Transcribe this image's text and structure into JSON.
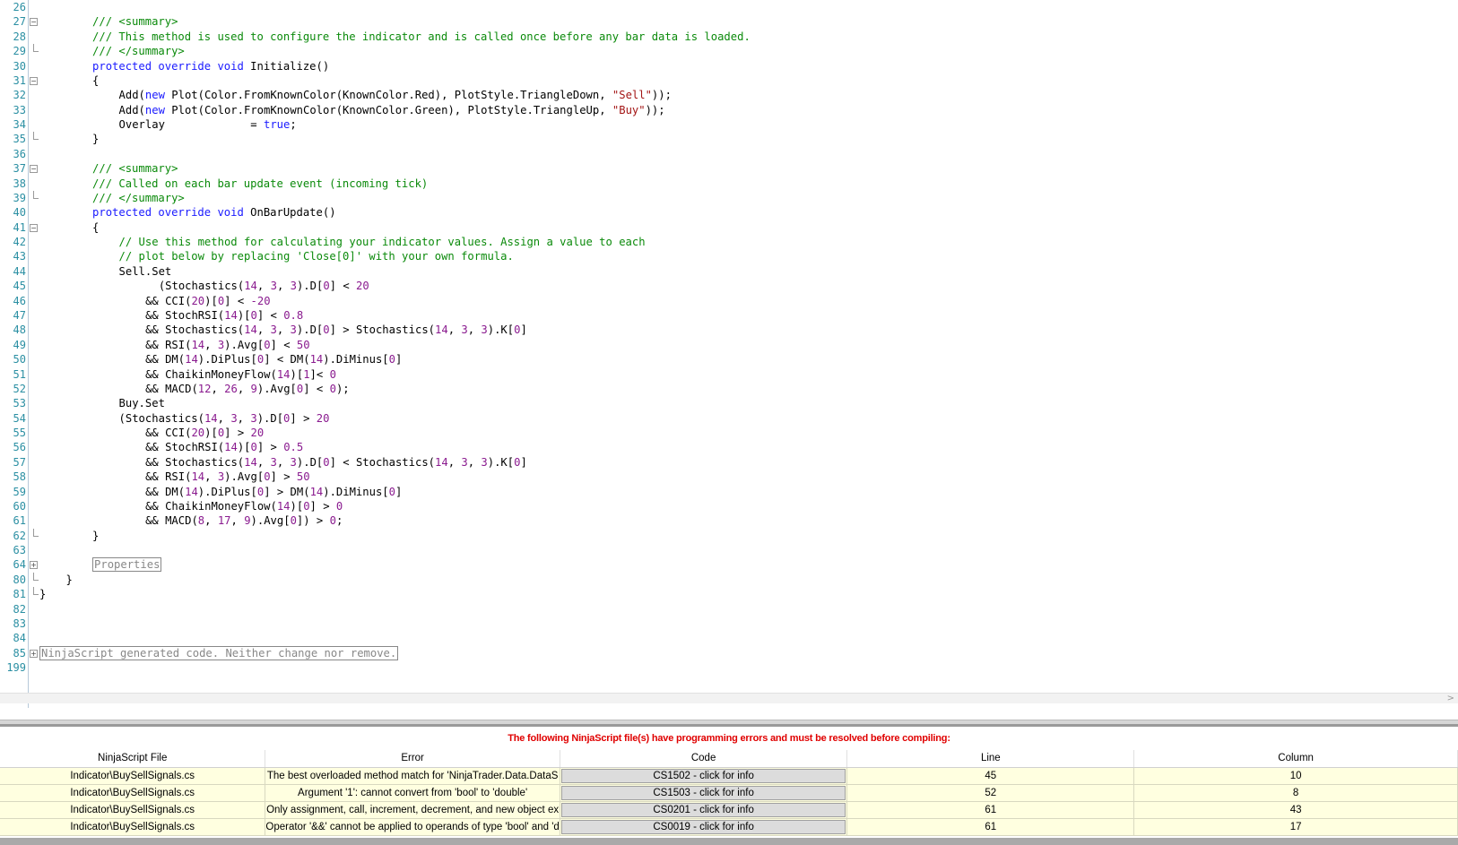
{
  "editor": {
    "lines": [
      {
        "n": "26",
        "fold": "none",
        "indent": 0,
        "parts": []
      },
      {
        "n": "27",
        "fold": "minus",
        "indent": 8,
        "parts": [
          [
            "cm",
            "/// <summary>"
          ]
        ]
      },
      {
        "n": "28",
        "fold": "line",
        "indent": 8,
        "parts": [
          [
            "cm",
            "/// This method is used to configure the indicator and is called once before any bar data is loaded."
          ]
        ]
      },
      {
        "n": "29",
        "fold": "end",
        "indent": 8,
        "parts": [
          [
            "cm",
            "/// </summary>"
          ]
        ]
      },
      {
        "n": "30",
        "fold": "line",
        "indent": 8,
        "parts": [
          [
            "kw",
            "protected override void "
          ],
          [
            "tx",
            "Initialize()"
          ]
        ]
      },
      {
        "n": "31",
        "fold": "minus",
        "indent": 8,
        "parts": [
          [
            "tx",
            "{"
          ]
        ]
      },
      {
        "n": "32",
        "fold": "line",
        "indent": 12,
        "parts": [
          [
            "tx",
            "Add("
          ],
          [
            "kw",
            "new "
          ],
          [
            "tx",
            "Plot(Color.FromKnownColor(KnownColor.Red), PlotStyle.TriangleDown, "
          ],
          [
            "str",
            "\"Sell\""
          ],
          [
            "tx",
            "));"
          ]
        ]
      },
      {
        "n": "33",
        "fold": "line",
        "indent": 12,
        "parts": [
          [
            "tx",
            "Add("
          ],
          [
            "kw",
            "new "
          ],
          [
            "tx",
            "Plot(Color.FromKnownColor(KnownColor.Green), PlotStyle.TriangleUp, "
          ],
          [
            "str",
            "\"Buy\""
          ],
          [
            "tx",
            "));"
          ]
        ]
      },
      {
        "n": "34",
        "fold": "line",
        "indent": 12,
        "parts": [
          [
            "tx",
            "Overlay             = "
          ],
          [
            "kw",
            "true"
          ],
          [
            "tx",
            ";"
          ]
        ]
      },
      {
        "n": "35",
        "fold": "end",
        "indent": 8,
        "parts": [
          [
            "tx",
            "}"
          ]
        ]
      },
      {
        "n": "36",
        "fold": "line",
        "indent": 0,
        "parts": []
      },
      {
        "n": "37",
        "fold": "minus",
        "indent": 8,
        "parts": [
          [
            "cm",
            "/// <summary>"
          ]
        ]
      },
      {
        "n": "38",
        "fold": "line",
        "indent": 8,
        "parts": [
          [
            "cm",
            "/// Called on each bar update event (incoming tick)"
          ]
        ]
      },
      {
        "n": "39",
        "fold": "end",
        "indent": 8,
        "parts": [
          [
            "cm",
            "/// </summary>"
          ]
        ]
      },
      {
        "n": "40",
        "fold": "line",
        "indent": 8,
        "parts": [
          [
            "kw",
            "protected override void "
          ],
          [
            "tx",
            "OnBarUpdate()"
          ]
        ]
      },
      {
        "n": "41",
        "fold": "minus",
        "indent": 8,
        "parts": [
          [
            "tx",
            "{"
          ]
        ]
      },
      {
        "n": "42",
        "fold": "line",
        "indent": 12,
        "parts": [
          [
            "cm",
            "// Use this method for calculating your indicator values. Assign a value to each"
          ]
        ]
      },
      {
        "n": "43",
        "fold": "line",
        "indent": 12,
        "parts": [
          [
            "cm",
            "// plot below by replacing 'Close[0]' with your own formula."
          ]
        ]
      },
      {
        "n": "44",
        "fold": "line",
        "indent": 12,
        "parts": [
          [
            "tx",
            "Sell.Set"
          ]
        ]
      },
      {
        "n": "45",
        "fold": "line",
        "indent": 18,
        "parts": [
          [
            "tx",
            "(Stochastics("
          ],
          [
            "num",
            "14"
          ],
          [
            "tx",
            ", "
          ],
          [
            "num",
            "3"
          ],
          [
            "tx",
            ", "
          ],
          [
            "num",
            "3"
          ],
          [
            "tx",
            ").D["
          ],
          [
            "num",
            "0"
          ],
          [
            "tx",
            "] < "
          ],
          [
            "num",
            "20"
          ]
        ]
      },
      {
        "n": "46",
        "fold": "line",
        "indent": 16,
        "parts": [
          [
            "tx",
            "&& CCI("
          ],
          [
            "num",
            "20"
          ],
          [
            "tx",
            ")["
          ],
          [
            "num",
            "0"
          ],
          [
            "tx",
            "] < "
          ],
          [
            "num",
            "-20"
          ]
        ]
      },
      {
        "n": "47",
        "fold": "line",
        "indent": 16,
        "parts": [
          [
            "tx",
            "&& StochRSI("
          ],
          [
            "num",
            "14"
          ],
          [
            "tx",
            ")["
          ],
          [
            "num",
            "0"
          ],
          [
            "tx",
            "] < "
          ],
          [
            "num",
            "0.8"
          ]
        ]
      },
      {
        "n": "48",
        "fold": "line",
        "indent": 16,
        "parts": [
          [
            "tx",
            "&& Stochastics("
          ],
          [
            "num",
            "14"
          ],
          [
            "tx",
            ", "
          ],
          [
            "num",
            "3"
          ],
          [
            "tx",
            ", "
          ],
          [
            "num",
            "3"
          ],
          [
            "tx",
            ").D["
          ],
          [
            "num",
            "0"
          ],
          [
            "tx",
            "] > Stochastics("
          ],
          [
            "num",
            "14"
          ],
          [
            "tx",
            ", "
          ],
          [
            "num",
            "3"
          ],
          [
            "tx",
            ", "
          ],
          [
            "num",
            "3"
          ],
          [
            "tx",
            ").K["
          ],
          [
            "num",
            "0"
          ],
          [
            "tx",
            "]"
          ]
        ]
      },
      {
        "n": "49",
        "fold": "line",
        "indent": 16,
        "parts": [
          [
            "tx",
            "&& RSI("
          ],
          [
            "num",
            "14"
          ],
          [
            "tx",
            ", "
          ],
          [
            "num",
            "3"
          ],
          [
            "tx",
            ").Avg["
          ],
          [
            "num",
            "0"
          ],
          [
            "tx",
            "] < "
          ],
          [
            "num",
            "50"
          ]
        ]
      },
      {
        "n": "50",
        "fold": "line",
        "indent": 16,
        "parts": [
          [
            "tx",
            "&& DM("
          ],
          [
            "num",
            "14"
          ],
          [
            "tx",
            ").DiPlus["
          ],
          [
            "num",
            "0"
          ],
          [
            "tx",
            "] < DM("
          ],
          [
            "num",
            "14"
          ],
          [
            "tx",
            ").DiMinus["
          ],
          [
            "num",
            "0"
          ],
          [
            "tx",
            "]"
          ]
        ]
      },
      {
        "n": "51",
        "fold": "line",
        "indent": 16,
        "parts": [
          [
            "tx",
            "&& ChaikinMoneyFlow("
          ],
          [
            "num",
            "14"
          ],
          [
            "tx",
            ")["
          ],
          [
            "num",
            "1"
          ],
          [
            "tx",
            "]< "
          ],
          [
            "num",
            "0"
          ]
        ]
      },
      {
        "n": "52",
        "fold": "line",
        "indent": 16,
        "parts": [
          [
            "tx",
            "&& MACD("
          ],
          [
            "num",
            "12"
          ],
          [
            "tx",
            ", "
          ],
          [
            "num",
            "26"
          ],
          [
            "tx",
            ", "
          ],
          [
            "num",
            "9"
          ],
          [
            "tx",
            ").Avg["
          ],
          [
            "num",
            "0"
          ],
          [
            "tx",
            "] < "
          ],
          [
            "num",
            "0"
          ],
          [
            "tx",
            ");"
          ]
        ]
      },
      {
        "n": "53",
        "fold": "line",
        "indent": 12,
        "parts": [
          [
            "tx",
            "Buy.Set"
          ]
        ]
      },
      {
        "n": "54",
        "fold": "line",
        "indent": 12,
        "parts": [
          [
            "tx",
            "(Stochastics("
          ],
          [
            "num",
            "14"
          ],
          [
            "tx",
            ", "
          ],
          [
            "num",
            "3"
          ],
          [
            "tx",
            ", "
          ],
          [
            "num",
            "3"
          ],
          [
            "tx",
            ").D["
          ],
          [
            "num",
            "0"
          ],
          [
            "tx",
            "] > "
          ],
          [
            "num",
            "20"
          ]
        ]
      },
      {
        "n": "55",
        "fold": "line",
        "indent": 16,
        "parts": [
          [
            "tx",
            "&& CCI("
          ],
          [
            "num",
            "20"
          ],
          [
            "tx",
            ")["
          ],
          [
            "num",
            "0"
          ],
          [
            "tx",
            "] > "
          ],
          [
            "num",
            "20"
          ]
        ]
      },
      {
        "n": "56",
        "fold": "line",
        "indent": 16,
        "parts": [
          [
            "tx",
            "&& StochRSI("
          ],
          [
            "num",
            "14"
          ],
          [
            "tx",
            ")["
          ],
          [
            "num",
            "0"
          ],
          [
            "tx",
            "] > "
          ],
          [
            "num",
            "0.5"
          ]
        ]
      },
      {
        "n": "57",
        "fold": "line",
        "indent": 16,
        "parts": [
          [
            "tx",
            "&& Stochastics("
          ],
          [
            "num",
            "14"
          ],
          [
            "tx",
            ", "
          ],
          [
            "num",
            "3"
          ],
          [
            "tx",
            ", "
          ],
          [
            "num",
            "3"
          ],
          [
            "tx",
            ").D["
          ],
          [
            "num",
            "0"
          ],
          [
            "tx",
            "] < Stochastics("
          ],
          [
            "num",
            "14"
          ],
          [
            "tx",
            ", "
          ],
          [
            "num",
            "3"
          ],
          [
            "tx",
            ", "
          ],
          [
            "num",
            "3"
          ],
          [
            "tx",
            ").K["
          ],
          [
            "num",
            "0"
          ],
          [
            "tx",
            "]"
          ]
        ]
      },
      {
        "n": "58",
        "fold": "line",
        "indent": 16,
        "parts": [
          [
            "tx",
            "&& RSI("
          ],
          [
            "num",
            "14"
          ],
          [
            "tx",
            ", "
          ],
          [
            "num",
            "3"
          ],
          [
            "tx",
            ").Avg["
          ],
          [
            "num",
            "0"
          ],
          [
            "tx",
            "] > "
          ],
          [
            "num",
            "50"
          ]
        ]
      },
      {
        "n": "59",
        "fold": "line",
        "indent": 16,
        "parts": [
          [
            "tx",
            "&& DM("
          ],
          [
            "num",
            "14"
          ],
          [
            "tx",
            ").DiPlus["
          ],
          [
            "num",
            "0"
          ],
          [
            "tx",
            "] > DM("
          ],
          [
            "num",
            "14"
          ],
          [
            "tx",
            ").DiMinus["
          ],
          [
            "num",
            "0"
          ],
          [
            "tx",
            "]"
          ]
        ]
      },
      {
        "n": "60",
        "fold": "line",
        "indent": 16,
        "parts": [
          [
            "tx",
            "&& ChaikinMoneyFlow("
          ],
          [
            "num",
            "14"
          ],
          [
            "tx",
            ")["
          ],
          [
            "num",
            "0"
          ],
          [
            "tx",
            "] > "
          ],
          [
            "num",
            "0"
          ]
        ]
      },
      {
        "n": "61",
        "fold": "line",
        "indent": 16,
        "parts": [
          [
            "tx",
            "&& MACD("
          ],
          [
            "num",
            "8"
          ],
          [
            "tx",
            ", "
          ],
          [
            "num",
            "17"
          ],
          [
            "tx",
            ", "
          ],
          [
            "num",
            "9"
          ],
          [
            "tx",
            ").Avg["
          ],
          [
            "num",
            "0"
          ],
          [
            "tx",
            "]) > "
          ],
          [
            "num",
            "0"
          ],
          [
            "tx",
            ";"
          ]
        ]
      },
      {
        "n": "62",
        "fold": "end",
        "indent": 8,
        "parts": [
          [
            "tx",
            "}"
          ]
        ]
      },
      {
        "n": "63",
        "fold": "line",
        "indent": 0,
        "parts": []
      },
      {
        "n": "64",
        "fold": "plus",
        "indent": 8,
        "parts": [
          [
            "box",
            "Properties"
          ]
        ]
      },
      {
        "n": "80",
        "fold": "end",
        "indent": 4,
        "parts": [
          [
            "tx",
            "}"
          ]
        ]
      },
      {
        "n": "81",
        "fold": "endroot",
        "indent": 0,
        "parts": [
          [
            "tx",
            "}"
          ]
        ]
      },
      {
        "n": "82",
        "fold": "none",
        "indent": 0,
        "parts": []
      },
      {
        "n": "83",
        "fold": "none",
        "indent": 0,
        "parts": []
      },
      {
        "n": "84",
        "fold": "none",
        "indent": 0,
        "parts": []
      },
      {
        "n": "85",
        "fold": "plusroot",
        "indent": 0,
        "parts": [
          [
            "box",
            "NinjaScript generated code. Neither change nor remove."
          ]
        ]
      },
      {
        "n": "199",
        "fold": "none",
        "indent": 0,
        "parts": []
      }
    ]
  },
  "scroll_arrow": ">",
  "errors": {
    "banner": "The following NinjaScript file(s) have programming errors and must be resolved before compiling:",
    "headers": [
      "NinjaScript File",
      "Error",
      "Code",
      "Line",
      "Column"
    ],
    "rows": [
      {
        "file": "Indicator\\BuySellSignals.cs",
        "error": "The best overloaded method match for 'NinjaTrader.Data.DataS",
        "code": "CS1502 - click for info",
        "line": "45",
        "column": "10"
      },
      {
        "file": "Indicator\\BuySellSignals.cs",
        "error": "Argument '1': cannot convert from 'bool' to 'double'",
        "code": "CS1503 - click for info",
        "line": "52",
        "column": "8"
      },
      {
        "file": "Indicator\\BuySellSignals.cs",
        "error": "Only assignment, call, increment, decrement, and new object ex",
        "code": "CS0201 - click for info",
        "line": "61",
        "column": "43"
      },
      {
        "file": "Indicator\\BuySellSignals.cs",
        "error": "Operator '&&' cannot be applied to operands of type 'bool' and 'd",
        "code": "CS0019 - click for info",
        "line": "61",
        "column": "17"
      }
    ]
  },
  "colors": {
    "comment": "#0b8a0b",
    "keyword": "#1a1aff",
    "string": "#a31515",
    "number": "#8a1b8f",
    "line_number": "#2b8fa3",
    "error_banner": "#e00000",
    "error_row_bg": "#ffffe0"
  }
}
